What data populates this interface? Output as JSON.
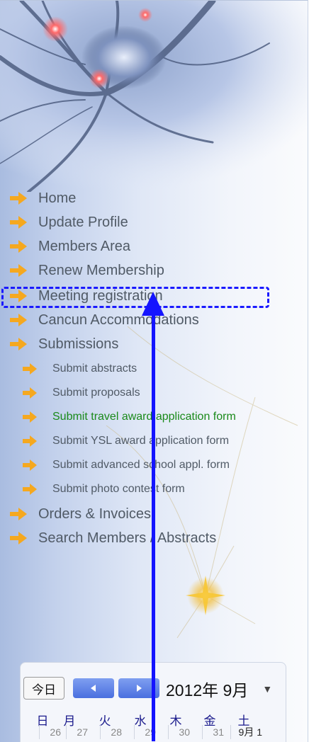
{
  "nav": {
    "items": [
      {
        "label": "Home"
      },
      {
        "label": "Update Profile"
      },
      {
        "label": "Members Area"
      },
      {
        "label": "Renew Membership"
      },
      {
        "label": "Meeting registration"
      },
      {
        "label": "Cancun Accommodations"
      },
      {
        "label": "Submissions"
      },
      {
        "label": "Submit abstracts"
      },
      {
        "label": "Submit proposals"
      },
      {
        "label": "Submit travel award application form"
      },
      {
        "label": "Submit YSL award application form"
      },
      {
        "label": "Submit advanced school appl. form"
      },
      {
        "label": "Submit photo contest form"
      },
      {
        "label": "Orders & Invoices"
      },
      {
        "label": "Search Members / Abstracts"
      }
    ],
    "highlighted": "Meeting registration",
    "active_color": "#1a8a1a",
    "arrow_color": "#f5a81f",
    "highlight_color": "#1a1aff"
  },
  "calendar": {
    "today_label": "今日",
    "month_label": "2012年 9月",
    "weekdays": [
      "日",
      "月",
      "火",
      "水",
      "木",
      "金",
      "土"
    ],
    "days": [
      "26",
      "27",
      "28",
      "29",
      "30",
      "31",
      "9月 1"
    ]
  }
}
